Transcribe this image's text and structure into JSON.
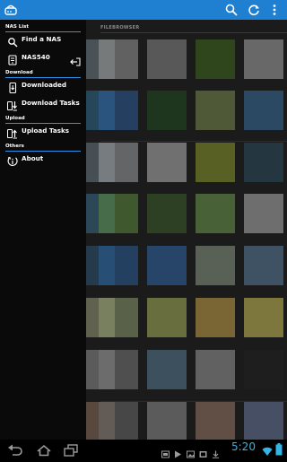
{
  "app": {
    "icons": [
      "app-logo-icon",
      "search-icon",
      "refresh-icon",
      "more-options-icon"
    ]
  },
  "drawer": {
    "sections": [
      {
        "header": "NAS List",
        "items": [
          {
            "label": "Find a NAS",
            "icon": "search-icon"
          },
          {
            "label": "NAS540",
            "icon": "nas-device-icon",
            "action_icon": "logout-icon"
          }
        ]
      },
      {
        "header": "Download",
        "items": [
          {
            "label": "Downloaded",
            "icon": "phone-download-icon"
          },
          {
            "label": "Download Tasks",
            "icon": "download-tasks-icon"
          }
        ]
      },
      {
        "header": "Upload",
        "items": [
          {
            "label": "Upload Tasks",
            "icon": "upload-tasks-icon"
          }
        ]
      },
      {
        "header": "Others",
        "items": [
          {
            "label": "About",
            "icon": "about-icon"
          }
        ]
      }
    ]
  },
  "gallery": {
    "title": "FILEBROWSER"
  },
  "system_bar": {
    "time": "5:20",
    "icons": [
      "back-icon",
      "home-icon",
      "recent-apps-icon",
      "play-icon",
      "gallery-icon",
      "storage-icon",
      "wifi-icon",
      "battery-icon"
    ]
  },
  "colors": {
    "action_bar": "#1f7fd1",
    "section_rule": "#2c93e8",
    "clock": "#33b5e5"
  }
}
